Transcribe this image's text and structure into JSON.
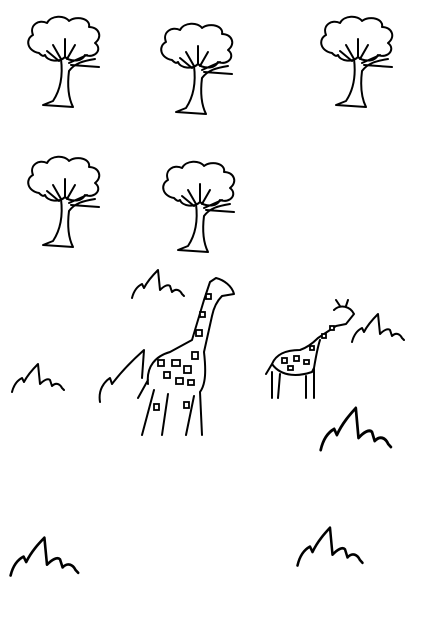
{
  "scene": {
    "background_color": "#ffffff",
    "line_color": "#000000",
    "trees": [
      "tree-icon",
      "tree-icon",
      "tree-icon",
      "tree-icon",
      "tree-icon"
    ],
    "giraffes": [
      "giraffe-icon",
      "giraffe-icon"
    ],
    "grass_clumps": 7
  }
}
